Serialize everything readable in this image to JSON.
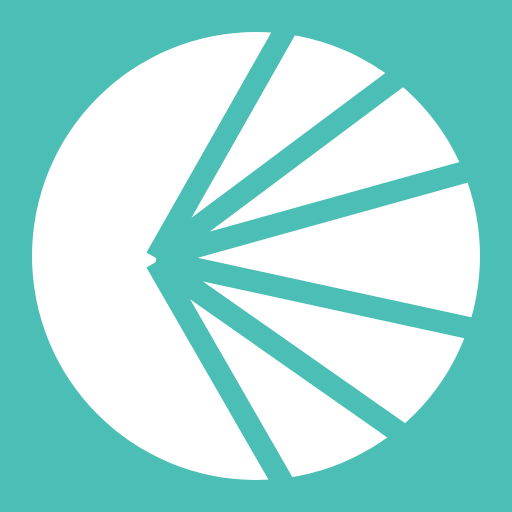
{
  "app_icon": {
    "name": "fan-circle-logo",
    "colors": {
      "background": "#4BBFB6",
      "foreground": "#FFFFFF",
      "rays": "#4BBFB6"
    }
  }
}
